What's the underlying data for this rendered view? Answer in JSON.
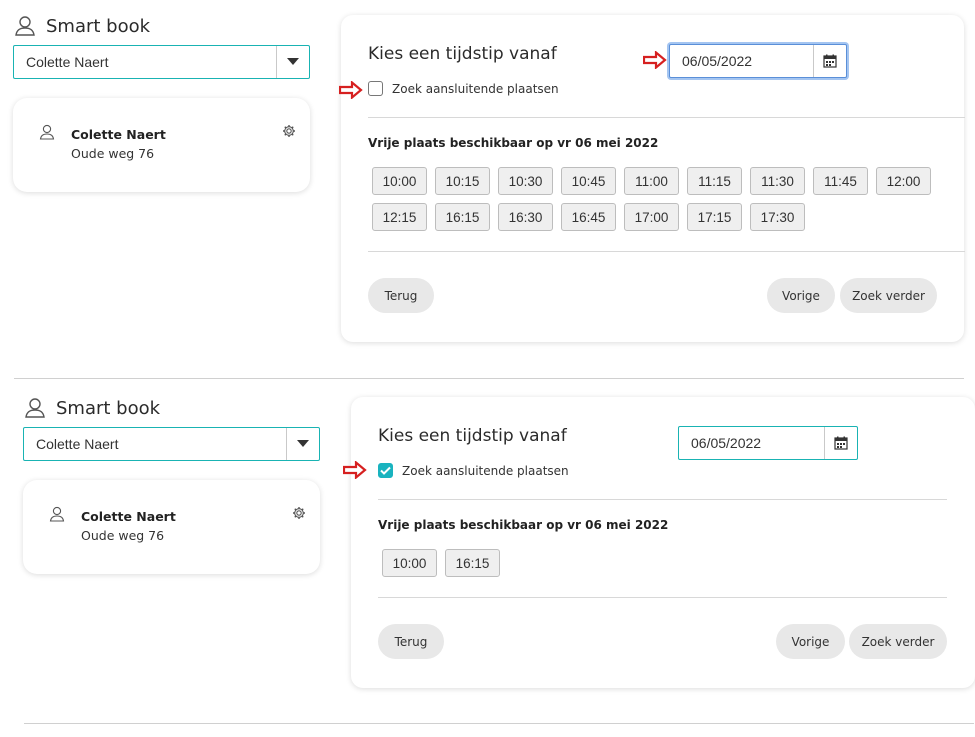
{
  "panels": [
    {
      "app_title": "Smart book",
      "selector_value": "Colette Naert",
      "person": {
        "name": "Colette Naert",
        "address": "Oude weg 76"
      },
      "main": {
        "title": "Kies een tijdstip vanaf",
        "date_value": "06/05/2022",
        "checkbox_label": "Zoek aansluitende plaatsen",
        "checkbox_checked": false,
        "available_label": "Vrije plaats beschikbaar op vr 06 mei 2022",
        "slots": [
          "10:00",
          "10:15",
          "10:30",
          "10:45",
          "11:00",
          "11:15",
          "11:30",
          "11:45",
          "12:00",
          "12:15",
          "16:15",
          "16:30",
          "16:45",
          "17:00",
          "17:15",
          "17:30"
        ],
        "buttons": {
          "back": "Terug",
          "previous": "Vorige",
          "search_more": "Zoek verder"
        }
      }
    },
    {
      "app_title": "Smart book",
      "selector_value": "Colette Naert",
      "person": {
        "name": "Colette Naert",
        "address": "Oude weg 76"
      },
      "main": {
        "title": "Kies een tijdstip vanaf",
        "date_value": "06/05/2022",
        "checkbox_label": "Zoek aansluitende plaatsen",
        "checkbox_checked": true,
        "available_label": "Vrije plaats beschikbaar op vr 06 mei 2022",
        "slots": [
          "10:00",
          "16:15"
        ],
        "buttons": {
          "back": "Terug",
          "previous": "Vorige",
          "search_more": "Zoek verder"
        }
      }
    }
  ],
  "icons": {
    "user": "user-outline-icon",
    "dropdown": "caret-down-icon",
    "settings": "gear-icon",
    "calendar": "calendar-icon",
    "annotation": "red-arrow-icon",
    "check": "checkmark-icon"
  },
  "colors": {
    "accent": "#19b3b3",
    "checkbox_checked": "#19b3bf",
    "annotation_arrow": "#d62020",
    "button_bg": "#e8e8e8",
    "slot_bg": "#efefef"
  }
}
